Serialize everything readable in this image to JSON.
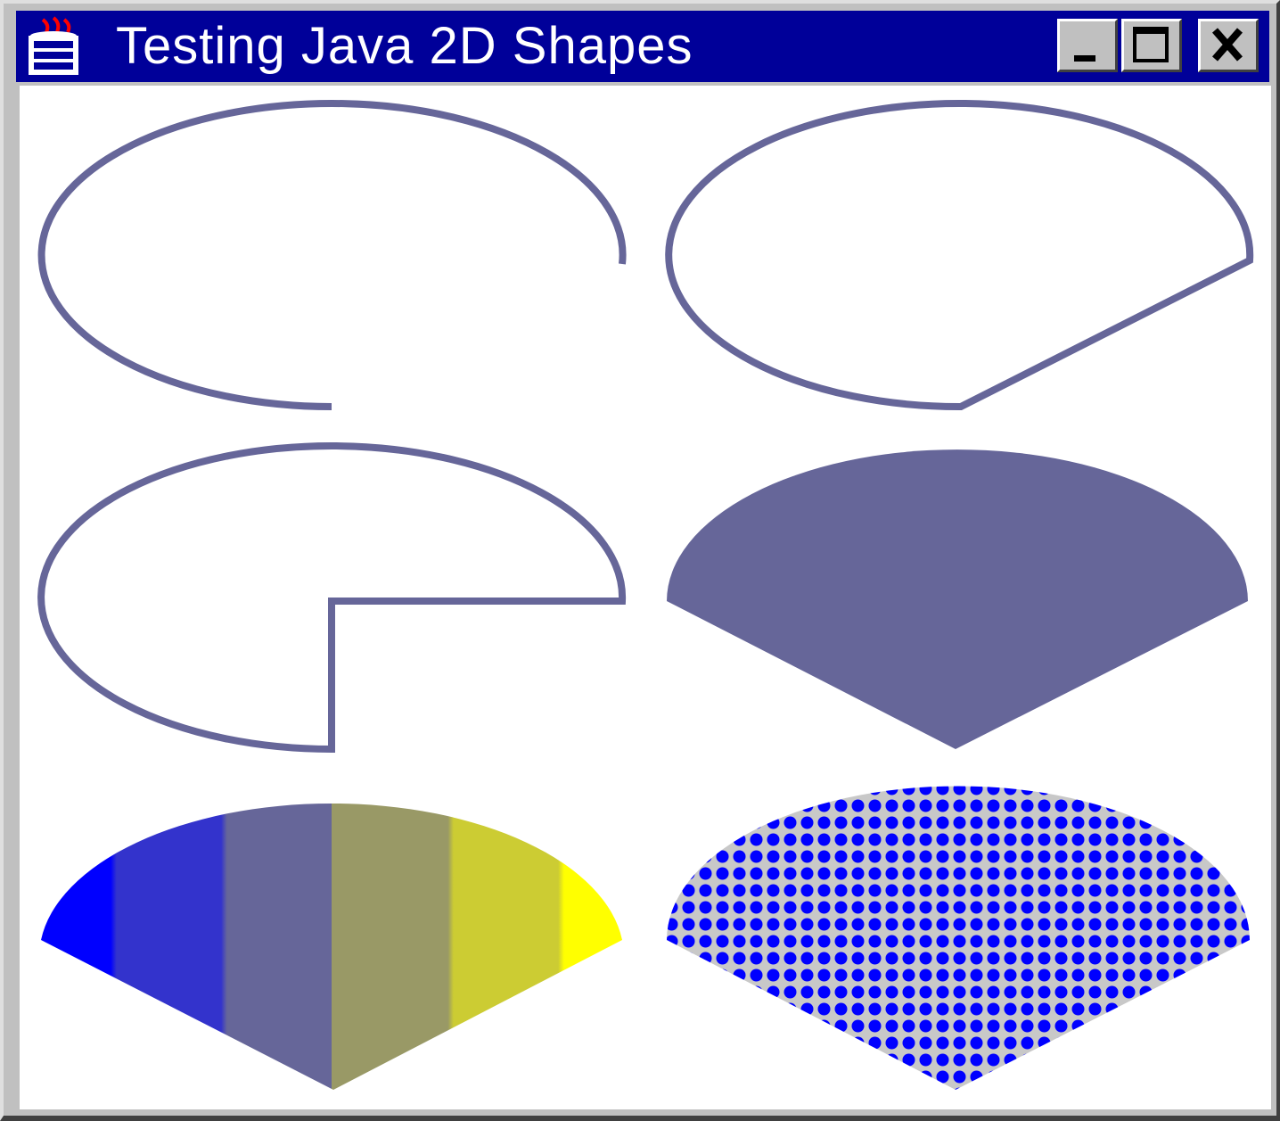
{
  "window": {
    "title": "Testing Java 2D Shapes"
  },
  "controls": {
    "minimize_icon": "minimize-icon",
    "maximize_icon": "maximize-icon",
    "close_icon": "close-icon"
  },
  "colors": {
    "titlebar": "#000099",
    "shape_stroke": "#666699",
    "gradient_start": "#0000ff",
    "gradient_end": "#ffff00",
    "texture_dots": "#0000ff",
    "texture_bg": "#c0c0c0"
  },
  "shapes": [
    {
      "kind": "open-arc-outline"
    },
    {
      "kind": "chord-arc-outline"
    },
    {
      "kind": "pie-arc-outline"
    },
    {
      "kind": "pie-arc-filled"
    },
    {
      "kind": "pie-arc-gradient"
    },
    {
      "kind": "pie-arc-textured"
    }
  ]
}
